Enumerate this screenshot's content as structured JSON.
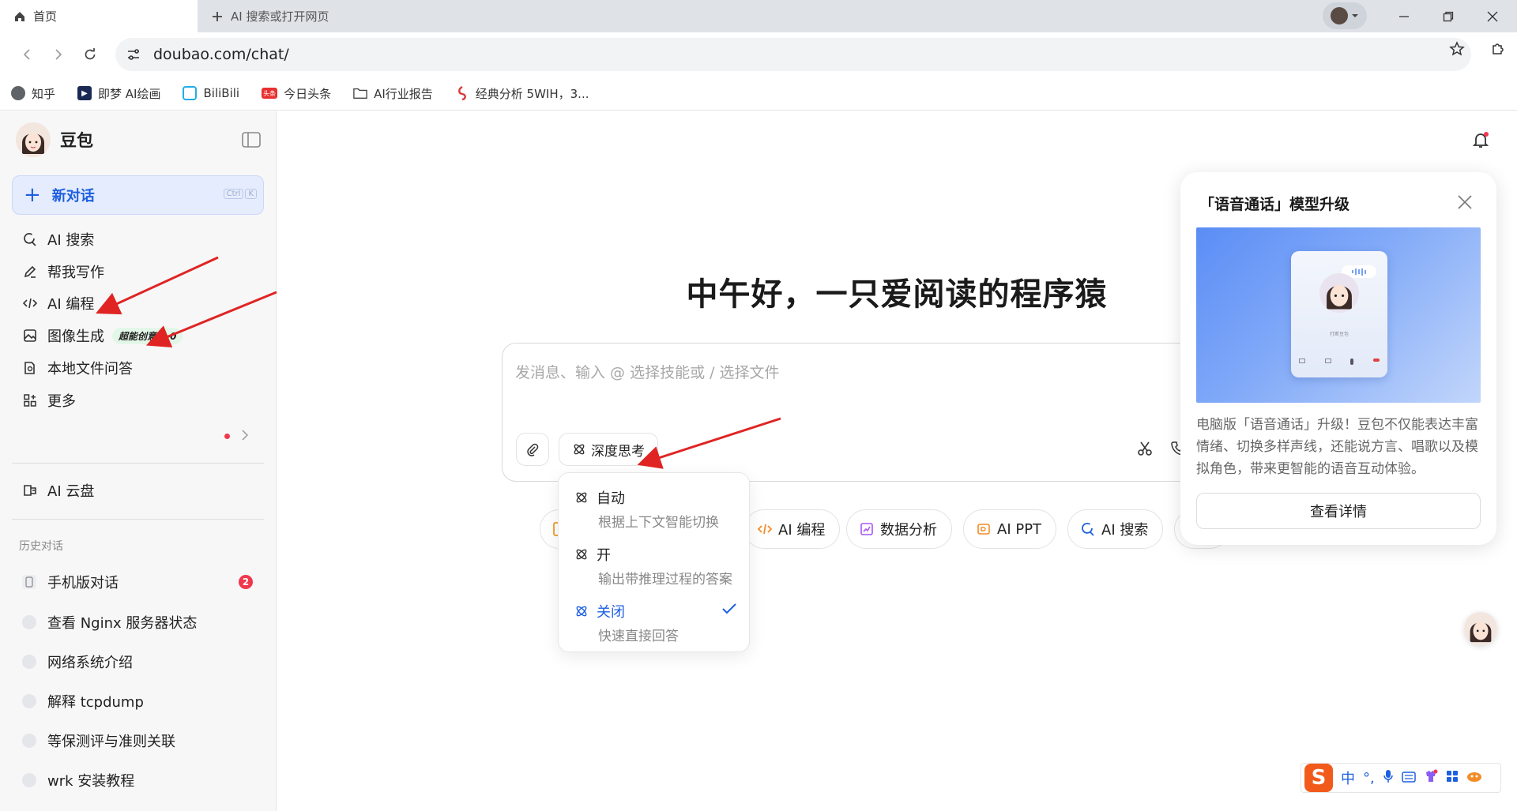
{
  "browser": {
    "tabs": [
      {
        "label": "首页"
      },
      {
        "label": "AI 搜索或打开网页"
      }
    ],
    "url": "doubao.com/chat/",
    "bookmarks": [
      {
        "label": "知乎"
      },
      {
        "label": "即梦 AI绘画"
      },
      {
        "label": "BiliBili"
      },
      {
        "label": "今日头条"
      },
      {
        "label": "AI行业报告"
      },
      {
        "label": "经典分析 5WIH，3..."
      }
    ]
  },
  "sidebar": {
    "brand": "豆包",
    "new_chat": {
      "label": "新对话",
      "kbd": [
        "Ctrl",
        "K"
      ]
    },
    "items": [
      {
        "label": "AI 搜索"
      },
      {
        "label": "帮我写作"
      },
      {
        "label": "AI 编程"
      },
      {
        "label": "图像生成",
        "badge": "超能创意 1.0"
      },
      {
        "label": "本地文件问答"
      },
      {
        "label": "更多"
      }
    ],
    "cloud": "AI 云盘",
    "history_title": "历史对话",
    "history": [
      {
        "label": "手机版对话",
        "count": "2"
      },
      {
        "label": "查看 Nginx 服务器状态"
      },
      {
        "label": "网络系统介绍"
      },
      {
        "label": "解释 tcpdump"
      },
      {
        "label": "等保测评与准则关联"
      },
      {
        "label": "wrk 安装教程"
      }
    ]
  },
  "main": {
    "greeting": "中午好，一只爱阅读的程序猿",
    "input_placeholder": "发消息、输入 @ 选择技能或 / 选择文件",
    "deep_think_label": "深度思考",
    "chips": [
      {
        "label": "AI 编程"
      },
      {
        "label": "数据分析"
      },
      {
        "label": "AI PPT"
      },
      {
        "label": "AI 搜索"
      }
    ],
    "deep_menu": [
      {
        "title": "自动",
        "desc": "根据上下文智能切换"
      },
      {
        "title": "开",
        "desc": "输出带推理过程的答案"
      },
      {
        "title": "关闭",
        "desc": "快速直接回答",
        "selected": true
      }
    ]
  },
  "promo": {
    "title": "「语音通话」模型升级",
    "image_caption": "打断豆包",
    "description": "电脑版「语音通话」升级！豆包不仅能表达丰富情绪、切换多样声线，还能说方言、唱歌以及模拟角色，带来更智能的语音互动体验。",
    "button": "查看详情"
  },
  "ime": {
    "mode": "中",
    "punct": "°,"
  },
  "colors": {
    "accent": "#1d5fe0",
    "arrow": "#e02424",
    "badge_red": "#f0384c"
  }
}
